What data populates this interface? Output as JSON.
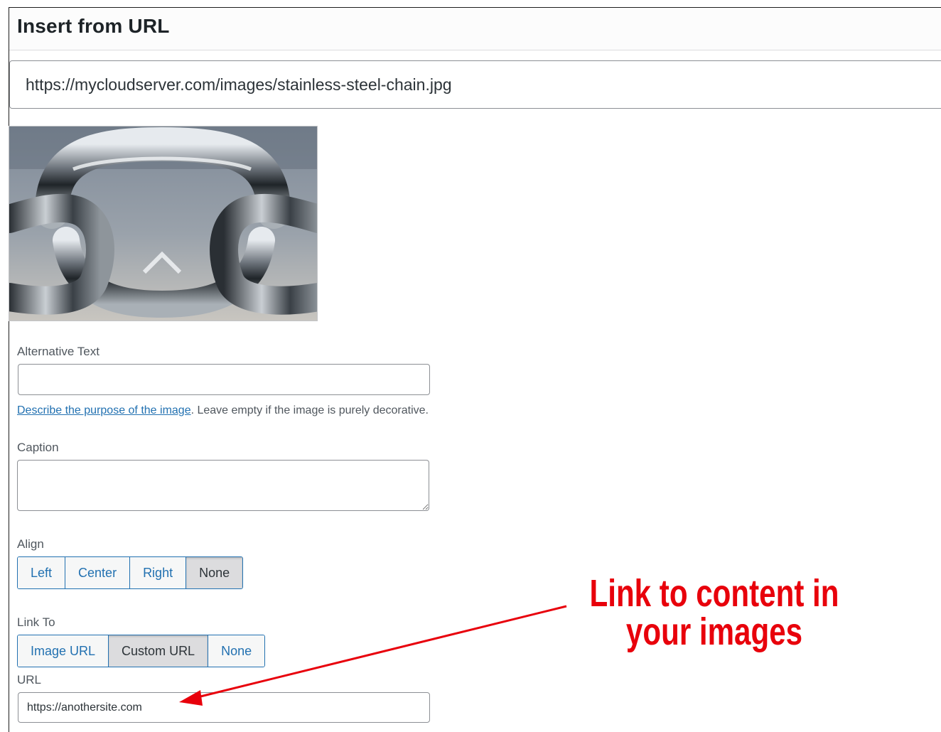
{
  "dialog": {
    "title": "Insert from URL",
    "image_url": "https://mycloudserver.com/images/stainless-steel-chain.jpg"
  },
  "alt_text": {
    "label": "Alternative Text",
    "value": "",
    "help_link": "Describe the purpose of the image",
    "help_suffix": ". Leave empty if the image is purely decorative."
  },
  "caption": {
    "label": "Caption",
    "value": ""
  },
  "align": {
    "label": "Align",
    "options": [
      "Left",
      "Center",
      "Right",
      "None"
    ],
    "selected": "None"
  },
  "link_to": {
    "label": "Link To",
    "options": [
      "Image URL",
      "Custom URL",
      "None"
    ],
    "selected": "Custom URL"
  },
  "url_field": {
    "label": "URL",
    "value": "https://anothersite.com"
  },
  "annotation": {
    "line1": "Link to content in",
    "line2": "your images",
    "color": "#e8000b"
  },
  "colors": {
    "link": "#2271b1",
    "border": "#8c8f94"
  },
  "icons": {
    "preview": "chain-link-photo",
    "arrow": "annotation-arrow"
  }
}
